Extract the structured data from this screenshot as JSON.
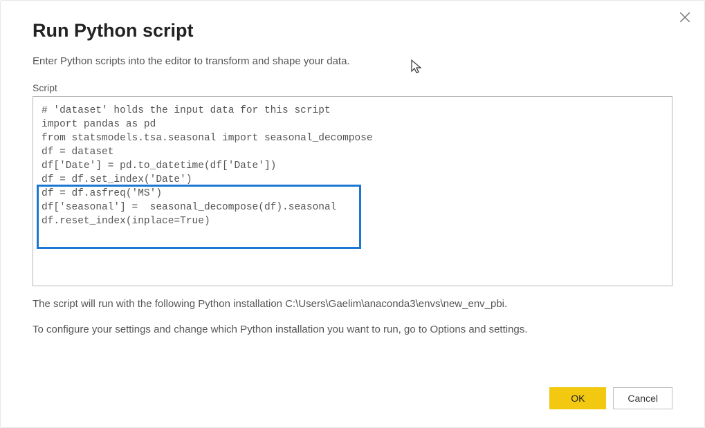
{
  "dialog": {
    "title": "Run Python script",
    "subtitle": "Enter Python scripts into the editor to transform and shape your data.",
    "script_label": "Script",
    "script_content": "# 'dataset' holds the input data for this script\nimport pandas as pd\nfrom statsmodels.tsa.seasonal import seasonal_decompose\ndf = dataset\ndf['Date'] = pd.to_datetime(df['Date'])\ndf = df.set_index('Date')\ndf = df.asfreq('MS')\ndf['seasonal'] =  seasonal_decompose(df).seasonal\ndf.reset_index(inplace=True)",
    "info_line1": "The script will run with the following Python installation C:\\Users\\Gaelim\\anaconda3\\envs\\new_env_pbi.",
    "info_line2": "To configure your settings and change which Python installation you want to run, go to Options and settings.",
    "ok_label": "OK",
    "cancel_label": "Cancel"
  }
}
